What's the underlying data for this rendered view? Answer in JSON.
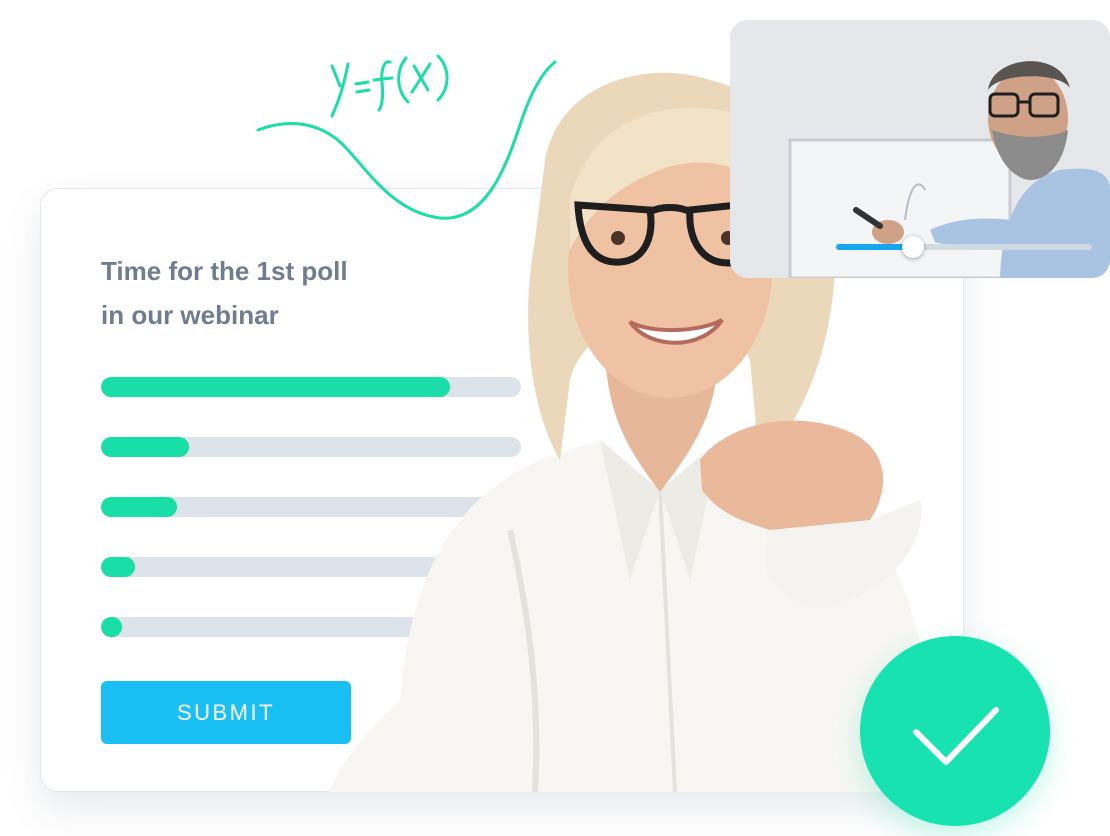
{
  "handwriting": {
    "formula": "y=f(x)",
    "stroke_color": "#19dea7"
  },
  "poll": {
    "title_line1": "Time for the 1st poll",
    "title_line2": "in our webinar",
    "bars": [
      {
        "percent": 83
      },
      {
        "percent": 21
      },
      {
        "percent": 18
      },
      {
        "percent": 8
      },
      {
        "percent": 5
      }
    ],
    "bar_fill_color": "#19dea7",
    "bar_track_color": "#dde3ea",
    "submit_label": "SUBMIT",
    "submit_color": "#1ac0f4"
  },
  "video": {
    "progress_percent": 30,
    "progress_color": "#15a8f0"
  },
  "badge": {
    "icon": "checkmark-icon",
    "color": "#17e2b0"
  }
}
